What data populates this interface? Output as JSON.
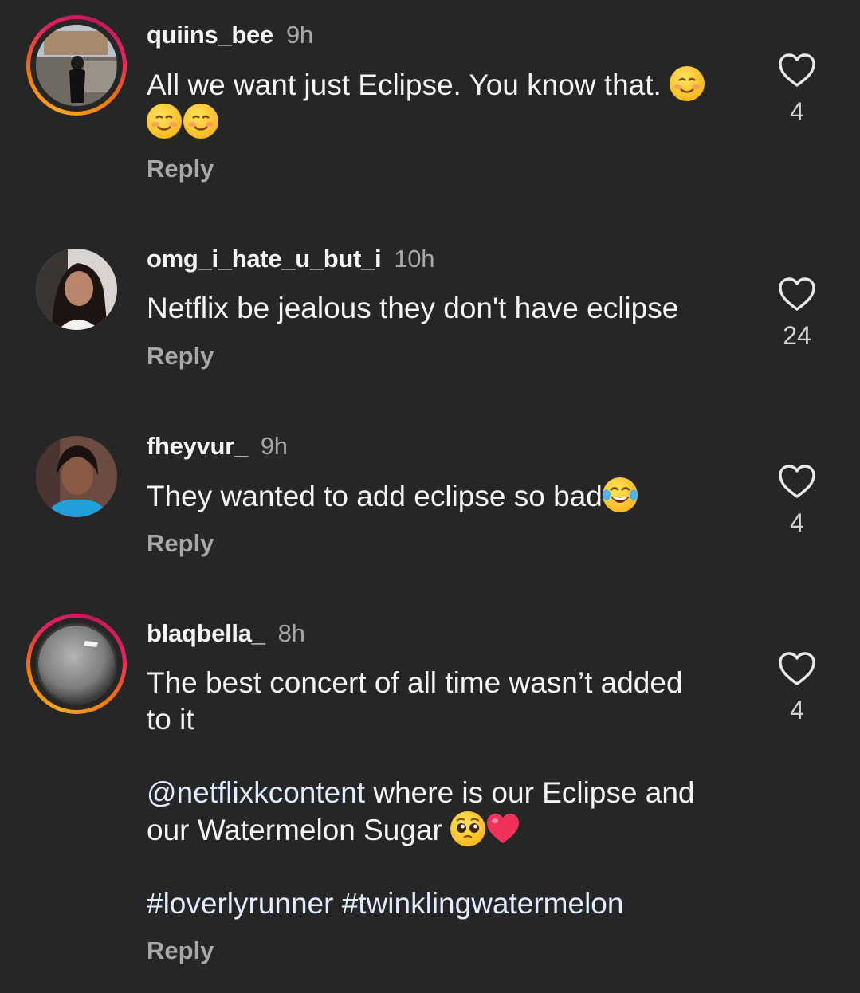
{
  "comments": [
    {
      "username": "quiins_bee",
      "time": "9h",
      "text_parts": [
        "All we want just Eclipse. You know that. "
      ],
      "emoji": [
        "smiling-face-emoji",
        "smiling-face-emoji",
        "smiling-face-emoji"
      ],
      "reply": "Reply",
      "likes": "4",
      "has_story": true
    },
    {
      "username": "omg_i_hate_u_but_i",
      "time": "10h",
      "text": "Netflix be jealous they don't have eclipse",
      "reply": "Reply",
      "likes": "24",
      "has_story": false
    },
    {
      "username": "fheyvur_",
      "time": "9h",
      "text": "They wanted to add eclipse so bad",
      "emoji": [
        "face-with-tears-of-joy-emoji"
      ],
      "reply": "Reply",
      "likes": "4",
      "has_story": false
    },
    {
      "username": "blaqbella_",
      "time": "8h",
      "text_line1": "The best concert of all time wasn’t added",
      "text_line2": "to it",
      "mention": "@netflixkcontent",
      "text_after_mention": " where is our Eclipse and",
      "text_line4": "our Watermelon Sugar ",
      "emoji": [
        "pleading-face-emoji",
        "red-heart-emoji"
      ],
      "hashtags": "#loverlyrunner #twinklingwatermelon",
      "reply": "Reply",
      "likes": "4",
      "has_story": true
    }
  ],
  "colors": {
    "background": "#262626",
    "text": "#f5f5f5",
    "secondary": "#a8a8a8",
    "link": "#e0ecff"
  },
  "icons": [
    "heart-outline-icon"
  ]
}
